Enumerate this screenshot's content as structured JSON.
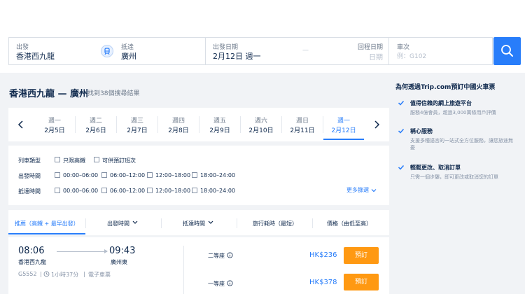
{
  "search": {
    "from_label": "出發",
    "from_value": "香港西九龍",
    "to_label": "抵達",
    "to_value": "廣州",
    "depart_label": "出發日期",
    "depart_value": "2月12日 週一",
    "return_label": "回程日期",
    "return_placeholder": "日期",
    "date_dash": "—",
    "train_label": "車次",
    "train_placeholder": "例：G102"
  },
  "route": {
    "title": "香港西九龍 — 廣州",
    "count": "找到38個搜尋結果"
  },
  "dates": [
    {
      "weekday": "週一",
      "date": "2月5日",
      "active": false
    },
    {
      "weekday": "週二",
      "date": "2月6日",
      "active": false
    },
    {
      "weekday": "週三",
      "date": "2月7日",
      "active": false
    },
    {
      "weekday": "週四",
      "date": "2月8日",
      "active": false
    },
    {
      "weekday": "週五",
      "date": "2月9日",
      "active": false
    },
    {
      "weekday": "週六",
      "date": "2月10日",
      "active": false
    },
    {
      "weekday": "週日",
      "date": "2月11日",
      "active": false
    },
    {
      "weekday": "週一",
      "date": "2月12日",
      "active": true
    }
  ],
  "filters": {
    "train_type_label": "列車類型",
    "train_type_options": [
      "只限高鐵",
      "可供預訂班次"
    ],
    "depart_time_label": "出發時間",
    "arrive_time_label": "抵達時間",
    "time_options": [
      "00:00–06:00",
      "06:00–12:00",
      "12:00–18:00",
      "18:00–24:00"
    ],
    "more": "更多篩選"
  },
  "sort": {
    "recommended": "推薦（高鐵 + 最早出發）",
    "depart_time": "出發時間",
    "arrive_time": "抵達時間",
    "duration": "旅行耗時（最短）",
    "price": "價格（由低至高）"
  },
  "result": {
    "depart_time": "08:06",
    "arrive_time": "09:43",
    "depart_station": "香港西九龍",
    "arrive_station": "廣州東",
    "train_no": "G5552",
    "duration": "1小時37分",
    "ticket_type": "電子車票",
    "seats": [
      {
        "class": "二等座",
        "price": "HK$236",
        "button": "預訂"
      },
      {
        "class": "一等座",
        "price": "HK$378",
        "button": "預訂"
      }
    ]
  },
  "sidebar": {
    "title": "為何透過Trip.com預訂中國火車票",
    "features": [
      {
        "title": "值得信賴的網上旅遊平台",
        "desc": "服務4億會員，超過3,000萬條用戶評價"
      },
      {
        "title": "稱心服務",
        "desc": "支援多種語言的一站式全方位服務，讓您旅途無憂"
      },
      {
        "title": "輕鬆更改、取消訂單",
        "desc": "只需一個步驟，即可更改或取消您的訂單"
      }
    ]
  },
  "colors": {
    "accent": "#287dfa",
    "book_button": "#ff9912",
    "text": "#0f294d"
  },
  "icons": {
    "swap": "train-swap-icon",
    "search": "search-icon",
    "prev": "chevron-left-icon",
    "next": "chevron-right-icon",
    "check": "check-icon",
    "info": "info-icon"
  }
}
